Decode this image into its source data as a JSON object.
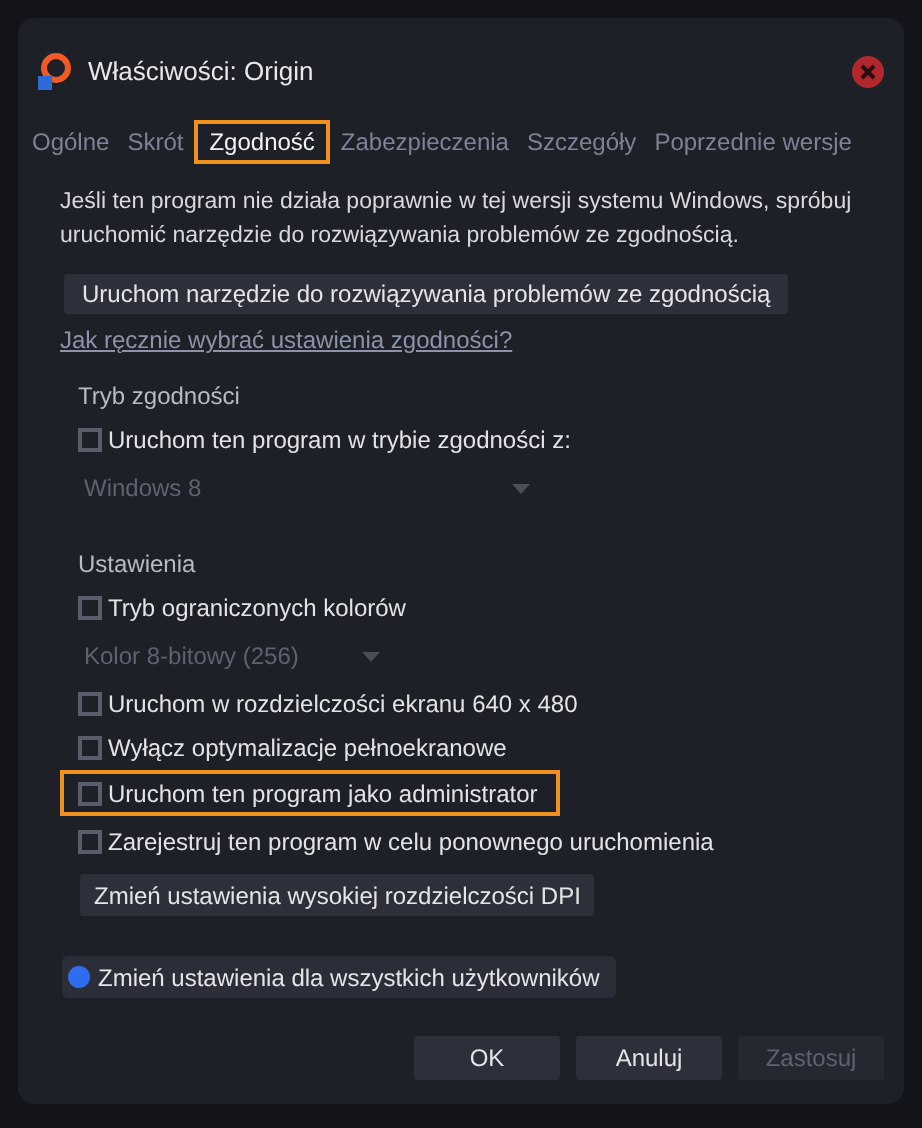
{
  "window": {
    "title": "Właściwości: Origin"
  },
  "tabs": [
    {
      "label": "Ogólne",
      "selected": false
    },
    {
      "label": "Skrót",
      "selected": false
    },
    {
      "label": "Zgodność",
      "selected": true
    },
    {
      "label": "Zabezpieczenia",
      "selected": false
    },
    {
      "label": "Szczegóły",
      "selected": false
    },
    {
      "label": "Poprzednie wersje",
      "selected": false
    }
  ],
  "intro": "Jeśli ten program nie działa poprawnie w tej wersji systemu Windows, spróbuj uruchomić narzędzie do rozwiązywania problemów ze zgodnością.",
  "troubleshoot_button": "Uruchom narzędzie do rozwiązywania problemów ze zgodnością",
  "help_link": "Jak ręcznie wybrać ustawienia zgodności?",
  "groups": [
    {
      "label": "Tryb zgodności",
      "items": [
        {
          "kind": "checkbox",
          "label": "Uruchom ten program w trybie zgodności z:",
          "checked": false,
          "highlighted": false
        },
        {
          "kind": "dropdown",
          "value": "Windows 8",
          "disabled": true
        }
      ]
    },
    {
      "label": "Ustawienia",
      "items": [
        {
          "kind": "checkbox",
          "label": "Tryb ograniczonych kolorów",
          "checked": false,
          "highlighted": false
        },
        {
          "kind": "dropdown",
          "value": "Kolor 8-bitowy (256)",
          "disabled": true
        },
        {
          "kind": "checkbox",
          "label": "Uruchom w rozdzielczości ekranu 640 x 480",
          "checked": false,
          "highlighted": false
        },
        {
          "kind": "checkbox",
          "label": "Wyłącz optymalizacje pełnoekranowe",
          "checked": false,
          "highlighted": false
        },
        {
          "kind": "checkbox",
          "label": "Uruchom ten program jako administrator",
          "checked": false,
          "highlighted": true
        },
        {
          "kind": "checkbox",
          "label": "Zarejestruj ten program w celu ponownego uruchomienia",
          "checked": false,
          "highlighted": false
        },
        {
          "kind": "button",
          "label": "Zmień ustawienia wysokiej rozdzielczości DPI"
        }
      ]
    }
  ],
  "all_users_button": "Zmień ustawienia dla wszystkich użytkowników",
  "buttons": [
    {
      "label": "OK",
      "disabled": false
    },
    {
      "label": "Anuluj",
      "disabled": false
    },
    {
      "label": "Zastosuj",
      "disabled": true
    }
  ]
}
